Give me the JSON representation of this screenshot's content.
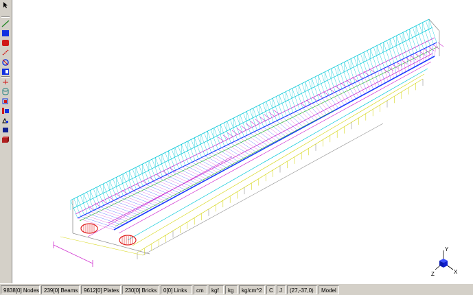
{
  "toolbar": {
    "tools": [
      "cursor-icon",
      "line-icon",
      "plate-icon",
      "brick-icon",
      "link-icon",
      "node-edit-icon",
      "subdivide-icon",
      "add-node-icon",
      "cylinder-icon",
      "restraint-icon",
      "load-icon",
      "copy-icon",
      "select-icon",
      "solid-view-icon"
    ]
  },
  "axis": {
    "x": "X",
    "y": "Y",
    "z": "Z"
  },
  "status": {
    "nodes": "9838[0] Nodes",
    "beams": "239[0] Beams",
    "plates": "9612[0] Plates",
    "bricks": "230[0] Bricks",
    "links": "0[0] Links",
    "length_unit": "cm",
    "force_unit": "kgf",
    "mass_unit": "kg",
    "stress_unit": "kg/cm^2",
    "mode_c": "C",
    "mode_j": "J",
    "coords": "(27,-37,0)",
    "view": "Model"
  },
  "colors": {
    "cyan": "#00c8d8",
    "blue": "#1a3cff",
    "magenta": "#d030d0",
    "red": "#e02020",
    "green": "#30c030",
    "yellow": "#d8d820",
    "gray": "#909090",
    "tan": "#c8b080"
  }
}
